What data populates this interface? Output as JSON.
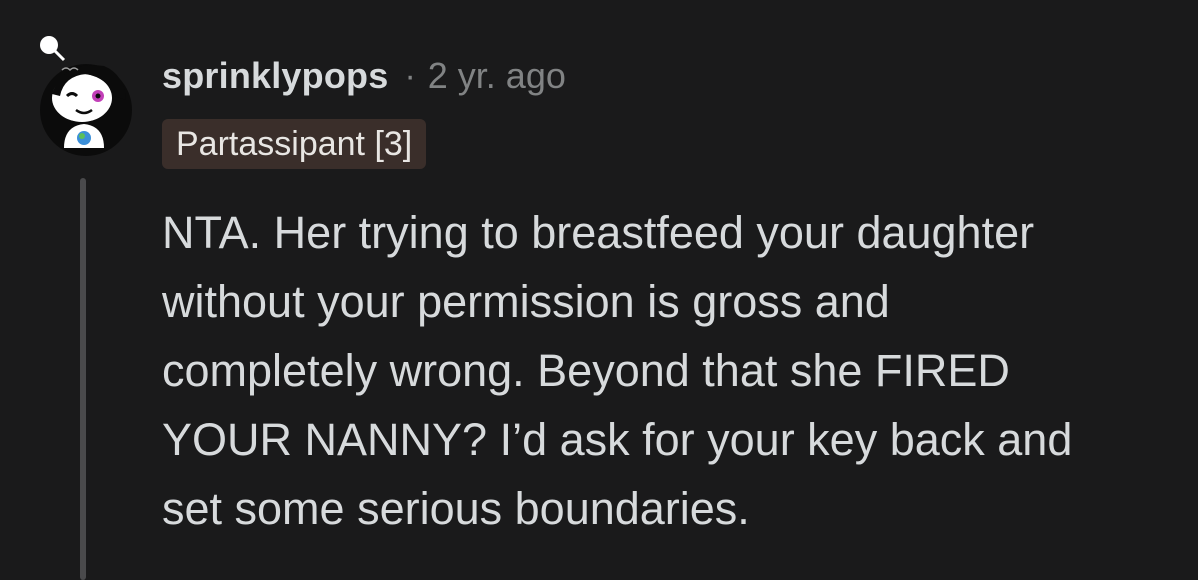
{
  "comment": {
    "username": "sprinklypops",
    "separator": "·",
    "timestamp": "2 yr. ago",
    "flair": "Partassipant [3]",
    "body_lines": [
      "NTA. Her trying to breastfeed your daughter",
      "without your permission is gross and",
      "completely wrong. Beyond that she FIRED",
      "YOUR NANNY? I’d ask for your key back and",
      "set some serious boundaries."
    ]
  },
  "colors": {
    "background": "#1a1a1b",
    "text": "#d7dadc",
    "meta": "#818384",
    "flair_bg": "#3a2e2a",
    "thread_line": "#4a4a4c"
  },
  "icons": {
    "avatar": "snoo-avatar-icon"
  }
}
